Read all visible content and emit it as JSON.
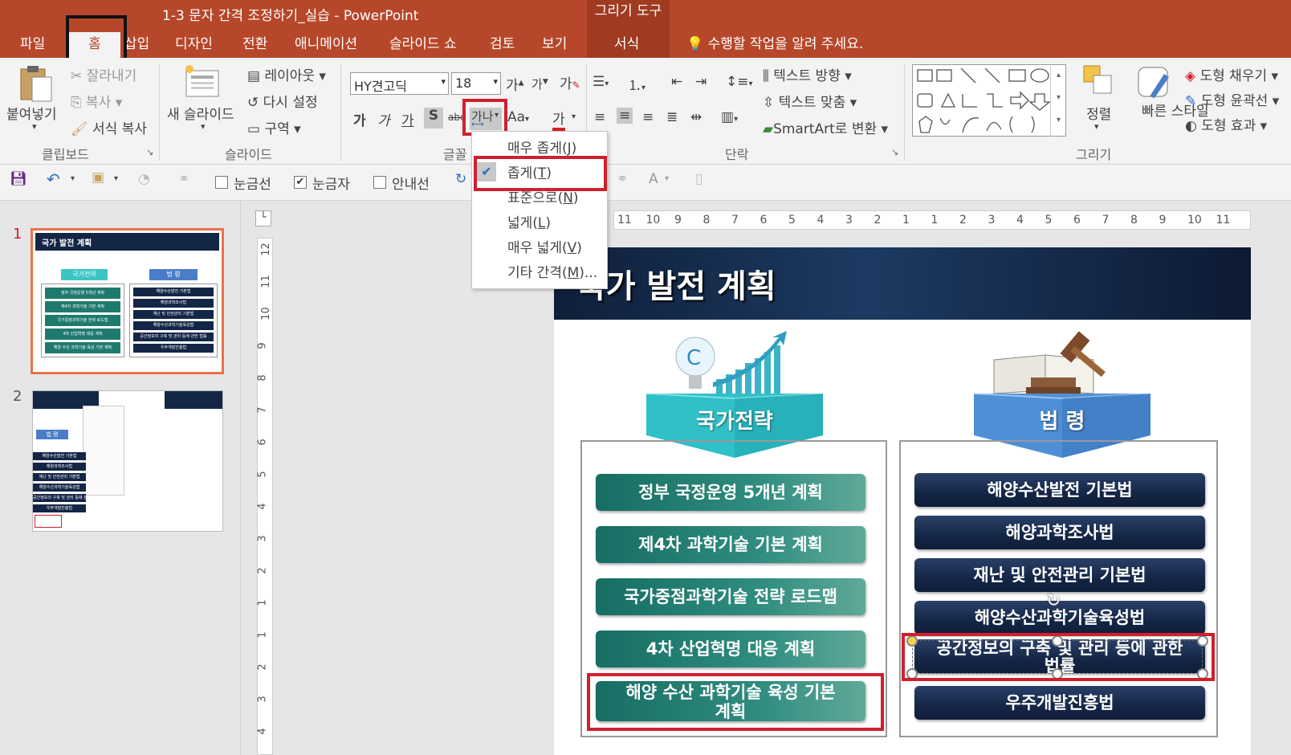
{
  "window": {
    "title": "1-3 문자 간격 조정하기_실습 - PowerPoint",
    "context_group": "그리기 도구"
  },
  "tabs": [
    "파일",
    "홈",
    "삽입",
    "디자인",
    "전환",
    "애니메이션",
    "슬라이드 쇼",
    "검토",
    "보기",
    "서식"
  ],
  "tell_me": "수행할 작업을 알려 주세요.",
  "clipboard": {
    "paste": "붙여넣기",
    "cut": "잘라내기",
    "copy": "복사",
    "format_painter": "서식 복사",
    "group": "클립보드"
  },
  "slides_group": {
    "new_slide": "새 슬라이드",
    "layout": "레이아웃",
    "reset": "다시 설정",
    "section": "구역",
    "group": "슬라이드"
  },
  "font": {
    "name": "HY견고딕",
    "size": "18",
    "grow": "가",
    "shrink": "가",
    "clear": "가",
    "bold": "가",
    "italic": "가",
    "underline": "가",
    "shadow": "S",
    "strike": "abc",
    "spacing": "가나",
    "case": "Aa",
    "color": "가",
    "group": "글꼴"
  },
  "paragraph": {
    "text_direction": "텍스트 방향",
    "align_text": "텍스트 맞춤",
    "smartart": "SmartArt로 변환",
    "group": "단락"
  },
  "drawing": {
    "arrange": "정렬",
    "quick_styles": "빠른 스타일",
    "fill": "도형 채우기",
    "outline": "도형 윤곽선",
    "effects": "도형 효과",
    "group": "그리기"
  },
  "qat": {
    "gridlines": "눈금선",
    "ruler": "눈금자",
    "guides": "안내선",
    "gridlines_checked": false,
    "ruler_checked": true,
    "guides_checked": false
  },
  "spacing_menu": [
    {
      "label": "매우 좁게",
      "key": "J"
    },
    {
      "label": "좁게",
      "key": "T"
    },
    {
      "label": "표준으로",
      "key": "N"
    },
    {
      "label": "넓게",
      "key": "L"
    },
    {
      "label": "매우 넓게",
      "key": "V"
    },
    {
      "label": "기타 간격",
      "key": "M",
      "suffix": "..."
    }
  ],
  "ruler_h": [
    "11",
    "10",
    "9",
    "8",
    "7",
    "6",
    "5",
    "4",
    "3",
    "2",
    "1",
    "1",
    "2",
    "3",
    "4",
    "5",
    "6",
    "7",
    "8",
    "9",
    "10",
    "11"
  ],
  "ruler_v": [
    "12",
    "11",
    "10",
    "9",
    "8",
    "7",
    "6",
    "5",
    "4",
    "3",
    "2",
    "1",
    "1",
    "2",
    "3",
    "4"
  ],
  "thumbnails": [
    {
      "number": "1",
      "title": "국가 발전 계획",
      "left_header": "국가전략",
      "right_header": "법 령",
      "left_items": [
        "정부 국정운영 5개년 계획",
        "제4차 과학기술 기본 계획",
        "국가중점과학기술 전략 로드맵",
        "4차 산업혁명 대응 계획",
        "해양 수산 과학기술 육성 기본 계획"
      ],
      "right_items": [
        "해양수산발전 기본법",
        "해양과학조사법",
        "재난 및 안전관리 기본법",
        "해양수산과학기술육성법",
        "공간정보의 구축 및 관리 등에 관한 법률",
        "우주개발진흥법"
      ]
    },
    {
      "number": "2",
      "header": "법 령",
      "items": [
        "해양수산발전 기본법",
        "해양과학조사법",
        "재난 및 안전관리 기본법",
        "해양수산과학기술육성법",
        "공간정보의 구축 및 관리 등에 관한 법률",
        "우주개발진흥법"
      ]
    }
  ],
  "slide": {
    "title": "국가 발전 계획",
    "left_header": "국가전략",
    "right_header": "법 령",
    "left_items": [
      "정부 국정운영 5개년 계획",
      "제4차 과학기술 기본 계획",
      "국가중점과학기술 전략 로드맵",
      "4차 산업혁명 대응 계획",
      "해양 수산 과학기술 육성 기본\n계획"
    ],
    "right_items": [
      "해양수산발전 기본법",
      "해양과학조사법",
      "재난 및 안전관리 기본법",
      "해양수산과학기술육성법",
      "공간정보의 구축 및 관리 등에 관한\n법률",
      "우주개발진흥법"
    ]
  },
  "colors": {
    "accent": "#b7472a",
    "highlight": "#d0202e",
    "teal": "#2f8c7e",
    "navy": "#142646"
  }
}
